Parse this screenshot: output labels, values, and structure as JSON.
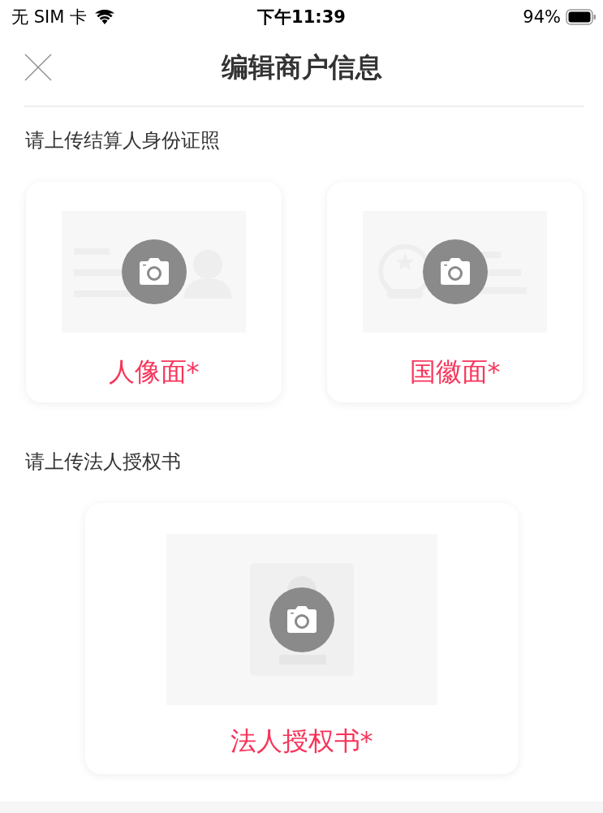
{
  "status_bar": {
    "carrier": "无 SIM 卡",
    "time": "下午11:39",
    "battery": "94%"
  },
  "nav": {
    "title": "编辑商户信息"
  },
  "sections": [
    {
      "title": "请上传结算人身份证照",
      "slots": [
        {
          "kind": "portrait",
          "label": "人像面*"
        },
        {
          "kind": "emblem",
          "label": "国徽面*"
        }
      ]
    },
    {
      "title": "请上传法人授权书",
      "slots": [
        {
          "kind": "letter",
          "label": "法人授权书*"
        }
      ]
    }
  ]
}
